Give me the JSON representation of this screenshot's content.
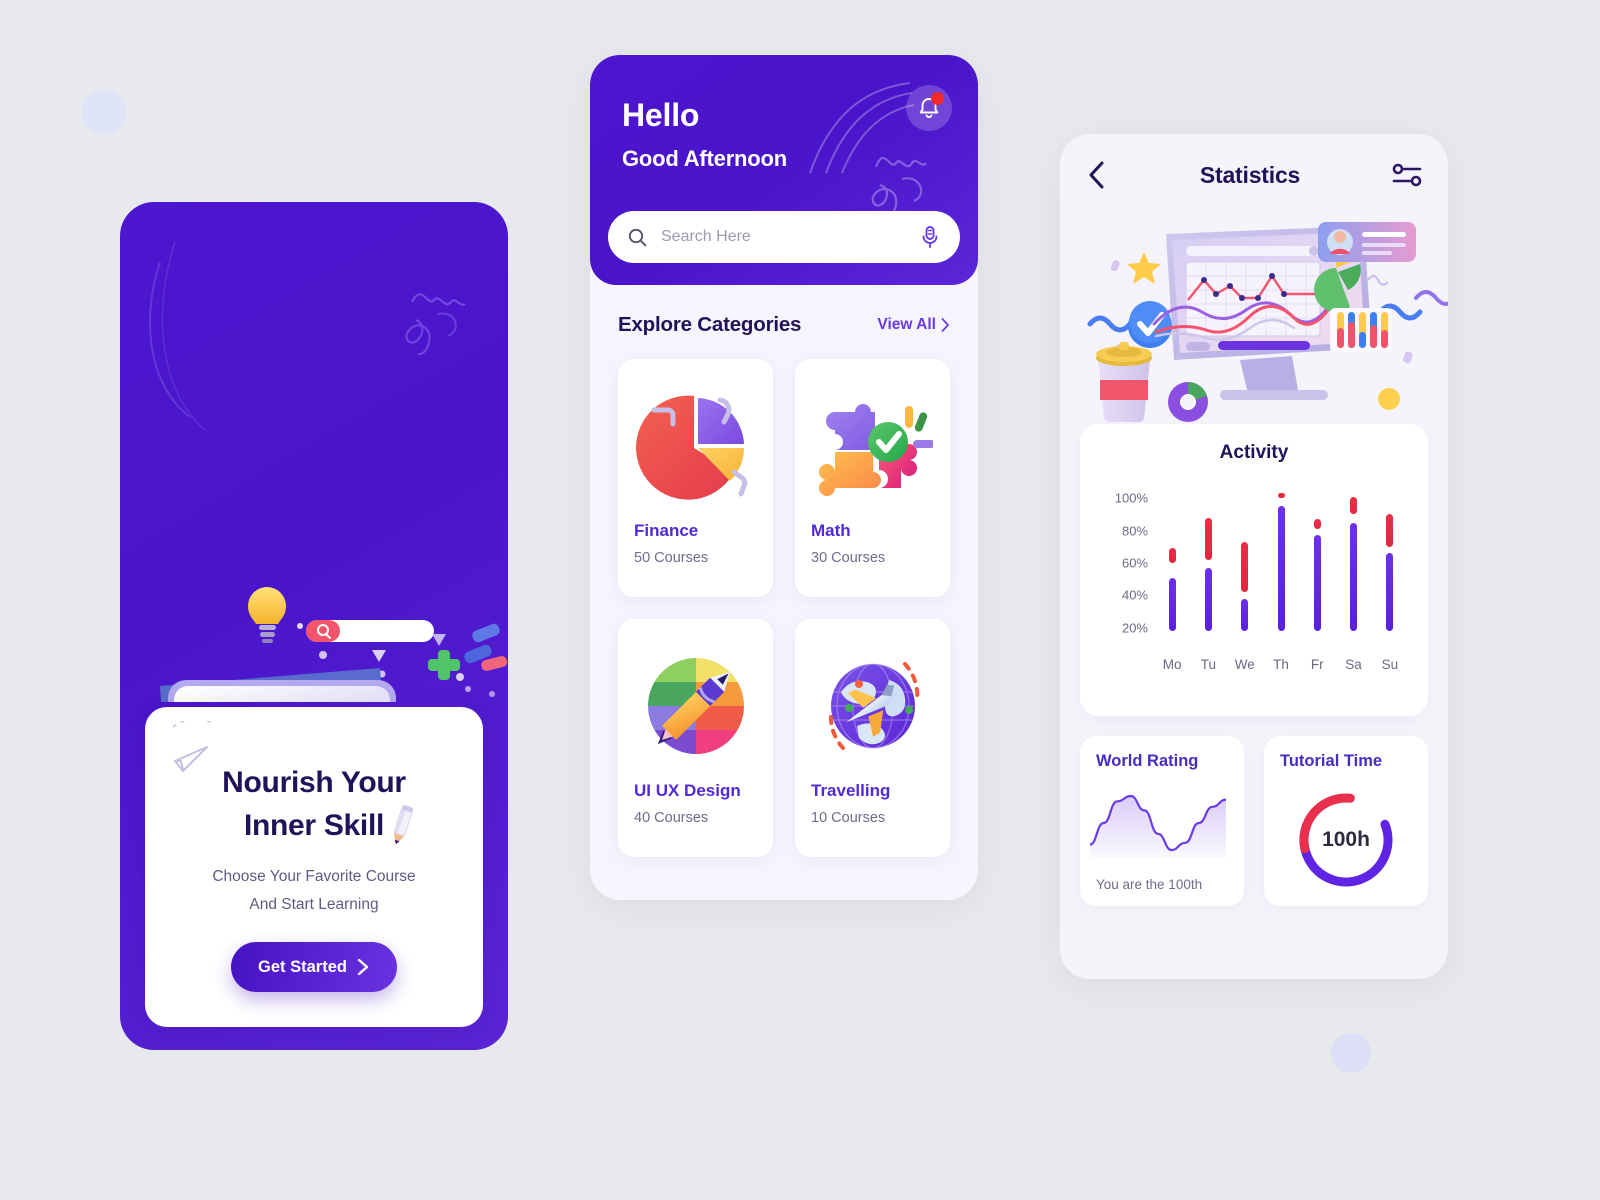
{
  "theme": {
    "primary_purple": "#4d16cf",
    "accent_purple": "#6b3ae8",
    "deep_navy": "#221258",
    "red": "#ef2c48",
    "page_background": "#e8e9ed"
  },
  "onboarding": {
    "title_line1": "Nourish Your",
    "title_line2": "Inner Skill",
    "subtitle_line1": "Choose Your Favorite Course",
    "subtitle_line2": "And Start Learning",
    "cta_label": "Get Started",
    "cta_chevron": "›",
    "illustration": "e-learning-tablet-books-illustration"
  },
  "home": {
    "greeting_title": "Hello",
    "greeting_subtitle": "Good Afternoon",
    "notification": {
      "icon": "bell-icon",
      "has_unread": true
    },
    "search": {
      "value": "",
      "placeholder": "Search Here",
      "left_icon": "search-icon",
      "right_icon": "microphone-icon"
    },
    "section_title": "Explore Categories",
    "view_all_label": "View All",
    "view_all_chevron": "›",
    "categories": [
      {
        "name": "Finance",
        "courses": "50 Courses",
        "icon": "pie-chart-illustration"
      },
      {
        "name": "Math",
        "courses": "30 Courses",
        "icon": "puzzle-check-illustration"
      },
      {
        "name": "UI UX Design",
        "courses": "40 Courses",
        "icon": "pencil-pen-color-wheel-illustration"
      },
      {
        "name": "Travelling",
        "courses": "10 Courses",
        "icon": "globe-airplane-illustration"
      }
    ]
  },
  "statistics": {
    "back_icon": "chevron-left-icon",
    "page_title": "Statistics",
    "filter_icon": "sliders-settings-icon",
    "illustration": "desktop-analytics-dashboard-illustration",
    "world_rating": {
      "title": "World Rating",
      "footer": "You are the 100th",
      "sparkline": [
        28,
        52,
        76,
        82,
        66,
        40,
        22,
        30,
        52,
        70,
        78
      ]
    },
    "tutorial_time": {
      "title": "Tutorial Time",
      "value": "100h",
      "purple_arc_pct": 62,
      "red_arc_pct": 30
    }
  },
  "chart_data": {
    "type": "bar",
    "title": "Activity",
    "xlabel": "",
    "ylabel": "",
    "ylim": [
      10,
      110
    ],
    "grid": false,
    "legend": "none",
    "categories": [
      "Mo",
      "Tu",
      "We",
      "Th",
      "Fr",
      "Sa",
      "Su"
    ],
    "ytick_labels": [
      "20%",
      "40%",
      "60%",
      "80%",
      "100%"
    ],
    "ytick_values": [
      20,
      40,
      60,
      80,
      100
    ],
    "series": [
      {
        "name": "Purple",
        "color": "#5f24e4",
        "base": 18,
        "values": [
          51,
          57,
          38,
          95,
          77,
          85,
          66
        ]
      },
      {
        "name": "Red",
        "color": "#ef2c48",
        "type": "floating",
        "lows": [
          60,
          62,
          42,
          100,
          81,
          90,
          70
        ],
        "highs": [
          69,
          88,
          73,
          103,
          87,
          101,
          90
        ]
      }
    ]
  }
}
